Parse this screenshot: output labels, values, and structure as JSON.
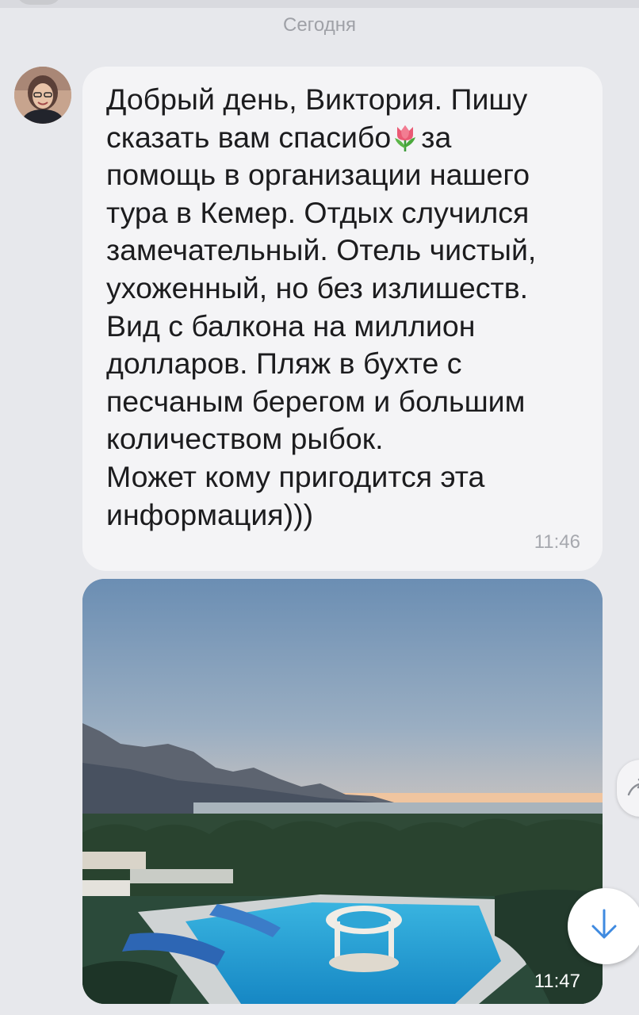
{
  "chat": {
    "date_separator": "Сегодня"
  },
  "message": {
    "lines": [
      "Добрый день, Виктория. Пишу",
      "сказать вам спасибо",
      "за",
      "помощь в организации нашего",
      "тура в Кемер. Отдых случился",
      "замечательный. Отель чистый,",
      "ухоженный, но без излишеств.",
      "Вид с балкона на миллион",
      "долларов. Пляж в бухте с",
      "песчаным берегом и большим",
      "количеством рыбок.",
      "Может кому пригодится эта",
      "информация)))"
    ],
    "emoji": "tulip-icon",
    "time": "11:46"
  },
  "photo_message": {
    "time": "11:47"
  },
  "icons": {
    "avatar": "avatar",
    "share": "share-icon",
    "scroll_down": "arrow-down-icon"
  },
  "colors": {
    "background": "#e7e8ec",
    "bubble": "#f4f4f6",
    "text": "#1c1c1e",
    "meta_text": "#a6a8ae",
    "accent": "#3f8ae0"
  }
}
